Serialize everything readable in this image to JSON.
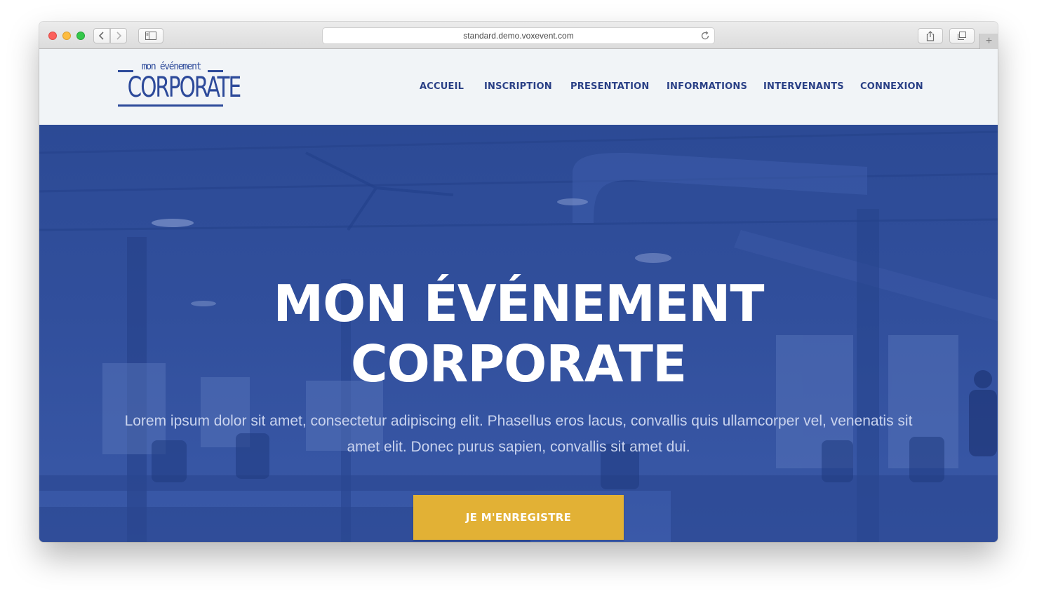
{
  "browser": {
    "url": "standard.demo.voxevent.com"
  },
  "site": {
    "logo": {
      "small_text": "mon événement",
      "big_text": "CORPORATE"
    },
    "nav": [
      "ACCUEIL",
      "INSCRIPTION",
      "PRESENTATION",
      "INFORMATIONS",
      "INTERVENANTS",
      "CONNEXION"
    ]
  },
  "hero": {
    "title_line1": "MON ÉVÉNEMENT",
    "title_line2": "CORPORATE",
    "subtitle": "Lorem ipsum dolor sit amet, consectetur adipiscing elit. Phasellus eros lacus, convallis quis ullamcorper vel, venenatis sit amet elit. Donec purus sapien, convallis sit amet dui.",
    "cta_label": "JE M'ENREGISTRE"
  },
  "colors": {
    "brand_blue": "#2d4a9a",
    "hero_blue": "#314f9c",
    "cta_yellow": "#e2b135",
    "header_bg": "#f1f4f7"
  }
}
